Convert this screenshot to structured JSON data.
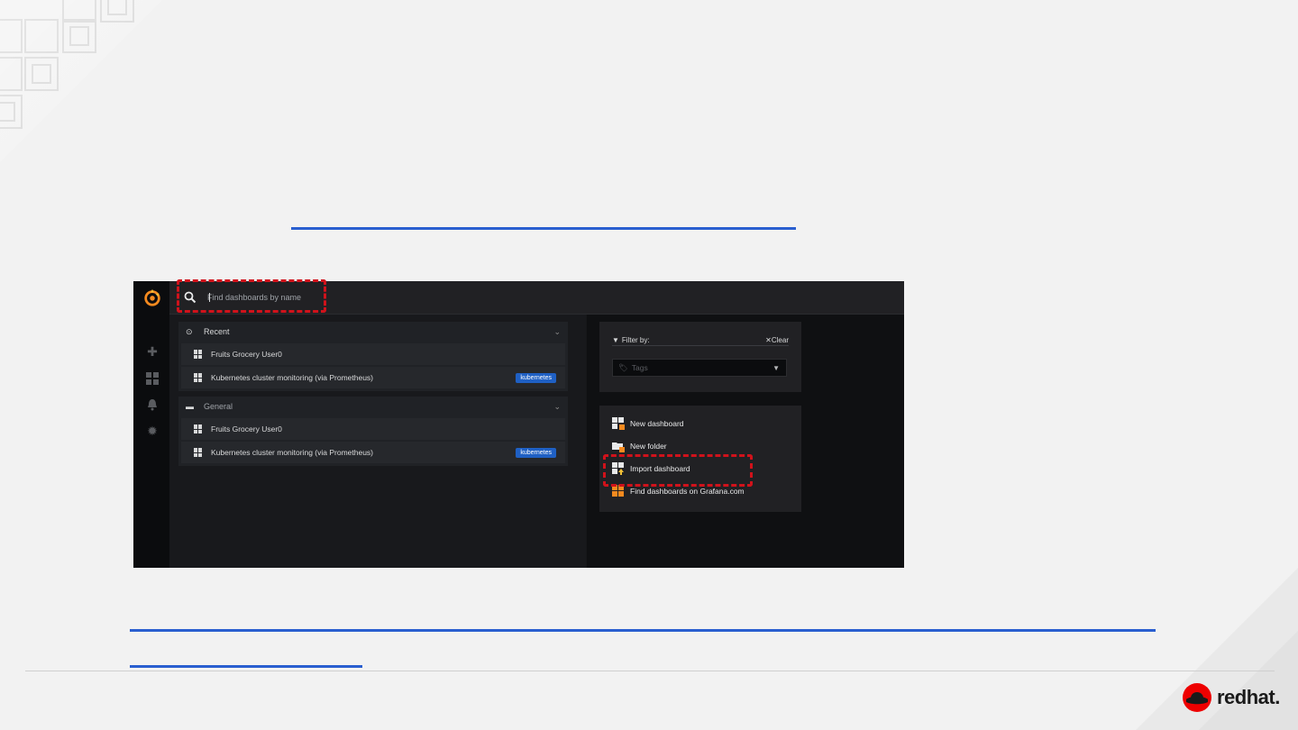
{
  "slide": {
    "brand": "redhat."
  },
  "grafana": {
    "search": {
      "placeholder": "Find dashboards by name"
    },
    "sidebar": {
      "icons": [
        "plus-icon",
        "dashboards-icon",
        "bell-icon",
        "gear-icon"
      ]
    },
    "sections": [
      {
        "title": "Recent",
        "icon": "clock-icon",
        "items": [
          {
            "label": "Fruits Grocery User0",
            "tag": ""
          },
          {
            "label": "Kubernetes cluster monitoring (via Prometheus)",
            "tag": "kubernetes"
          }
        ]
      },
      {
        "title": "General",
        "icon": "folder-icon",
        "items": [
          {
            "label": "Fruits Grocery User0",
            "tag": ""
          },
          {
            "label": "Kubernetes cluster monitoring (via Prometheus)",
            "tag": "kubernetes"
          }
        ]
      }
    ],
    "filter": {
      "label": "Filter by:",
      "clear": "Clear",
      "tags_placeholder": "Tags"
    },
    "actions": [
      {
        "label": "New dashboard",
        "icon": "new-dashboard-icon"
      },
      {
        "label": "New folder",
        "icon": "new-folder-icon"
      },
      {
        "label": "Import dashboard",
        "icon": "import-dashboard-icon"
      },
      {
        "label": "Find dashboards on Grafana.com",
        "icon": "grafana-com-icon"
      }
    ]
  },
  "colors": {
    "accent_line": "#2a5fd0",
    "highlight": "#d0121b",
    "brand_red": "#ee0000",
    "tag_badge": "#1f60c4"
  }
}
